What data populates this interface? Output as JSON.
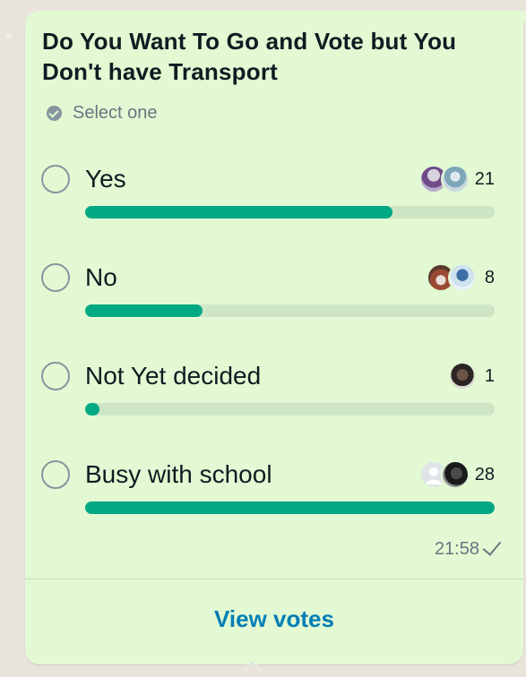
{
  "poll": {
    "question": "Do You Want To Go and Vote but You Don't have Transport",
    "select_hint": "Select one",
    "options": [
      {
        "label": "Yes",
        "votes": "21",
        "fraction": 0.75,
        "avatars": [
          "avatar-a",
          "avatar-b"
        ]
      },
      {
        "label": "No",
        "votes": "8",
        "fraction": 0.286,
        "avatars": [
          "avatar-c",
          "avatar-d"
        ]
      },
      {
        "label": "Not Yet decided",
        "votes": "1",
        "fraction": 0.036,
        "avatars": [
          "avatar-e"
        ]
      },
      {
        "label": "Busy with school",
        "votes": "28",
        "fraction": 1.0,
        "avatars": [
          "default-avatar",
          "avatar-f"
        ]
      }
    ],
    "time": "21:58",
    "status_icon": "single-check-icon",
    "view_votes_label": "View votes"
  },
  "colors": {
    "bubble": "#e2f9d3",
    "bar_fill": "#00a884",
    "bar_track": "#cfe6c6",
    "link": "#027eb5"
  }
}
